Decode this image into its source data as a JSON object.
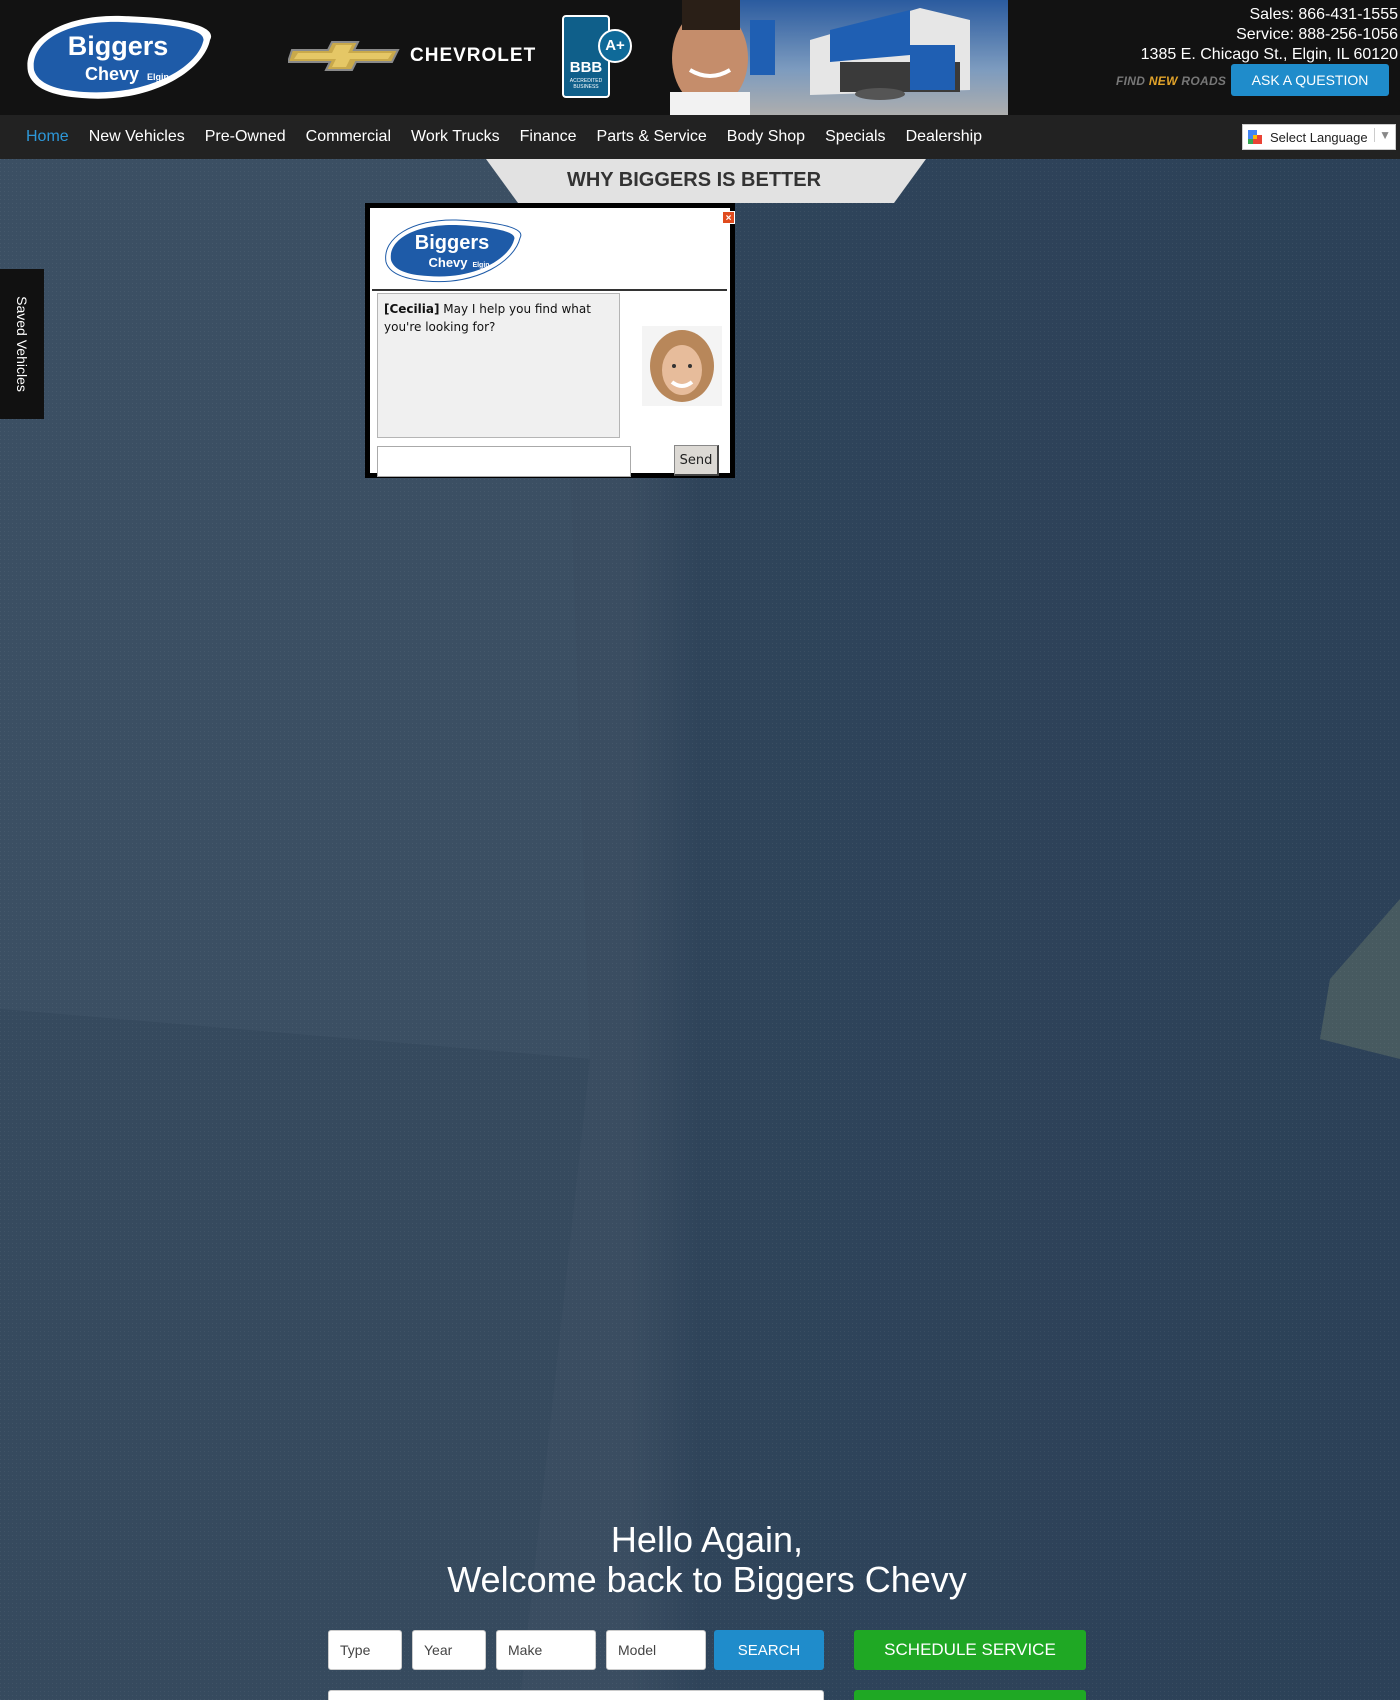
{
  "header": {
    "logo_text_main": "Biggers",
    "logo_text_sub": "Chevy",
    "logo_text_city": "Elgin",
    "brand": "CHEVROLET",
    "bbb": {
      "letters": "BBB",
      "rating": "A+",
      "caption": "ACCREDITED BUSINESS"
    },
    "contact": {
      "sales": "Sales: 866-431-1555",
      "service": "Service: 888-256-1056",
      "address": "1385 E. Chicago St., Elgin, IL 60120"
    },
    "tagline_find": "FIND ",
    "tagline_new": "NEW",
    "tagline_roads": " ROADS",
    "ask_button": "ASK A QUESTION"
  },
  "nav": {
    "items": [
      {
        "label": "Home"
      },
      {
        "label": "New Vehicles"
      },
      {
        "label": "Pre-Owned"
      },
      {
        "label": "Commercial"
      },
      {
        "label": "Work Trucks"
      },
      {
        "label": "Finance"
      },
      {
        "label": "Parts & Service"
      },
      {
        "label": "Body Shop"
      },
      {
        "label": "Specials"
      },
      {
        "label": "Dealership"
      }
    ],
    "active": "Home",
    "language": "Select Language"
  },
  "why_tab": "WHY BIGGERS IS BETTER",
  "saved_vehicles": "Saved Vehicles",
  "chat": {
    "close": "×",
    "agent": "[Cecilia]",
    "message": " May I help you find what you're looking for?",
    "input_value": "",
    "send": "Send"
  },
  "hero": {
    "line1": "Hello Again,",
    "line2": "Welcome back to Biggers Chevy"
  },
  "search": {
    "type": "Type",
    "year": "Year",
    "make": "Make",
    "model": "Model",
    "button": "SEARCH",
    "schedule": "SCHEDULE SERVICE"
  },
  "colors": {
    "accent_blue": "#1f8ccb",
    "green": "#1fa824",
    "header_bg": "#121212",
    "nav_active": "#2d97d8",
    "page_bg": "#2e4258"
  }
}
